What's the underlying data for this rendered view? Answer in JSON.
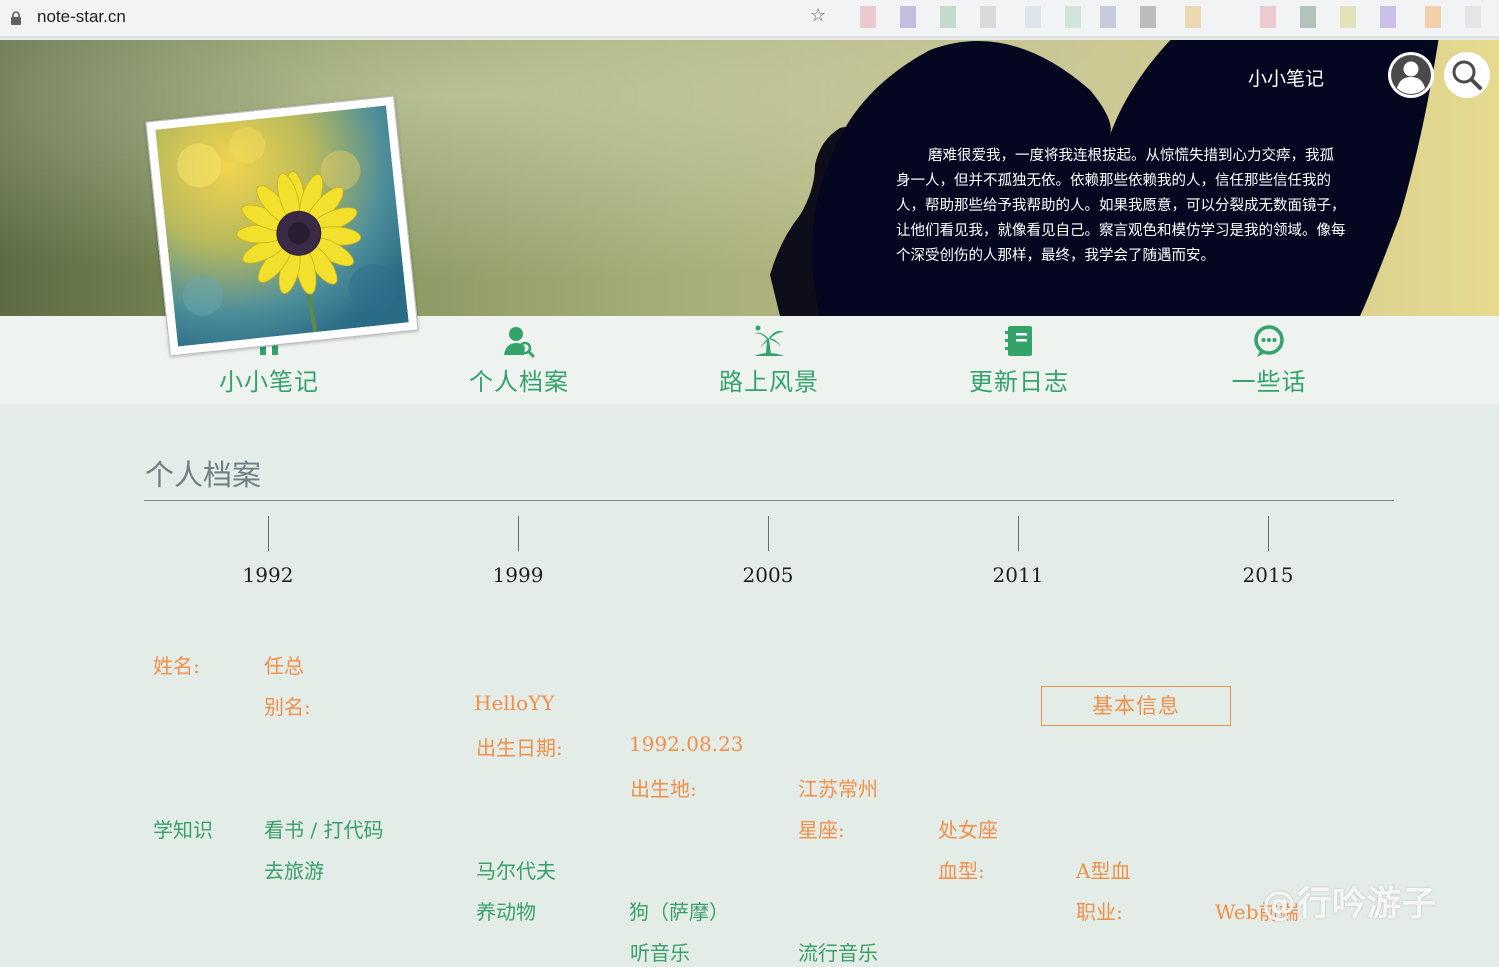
{
  "browser": {
    "url": "note-star.cn"
  },
  "header": {
    "site_title": "小小笔记",
    "quote": "磨难很爱我，一度将我连根拔起。从惊慌失措到心力交瘁，我孤身一人，但并不孤独无依。依赖那些依赖我的人，信任那些信任我的人，帮助那些给予我帮助的人。如果我愿意，可以分裂成无数面镜子，让他们看见我，就像看见自己。察言观色和模仿学习是我的领域。像每个深受创伤的人那样，最终，我学会了随遇而安。"
  },
  "nav": {
    "items": [
      {
        "label": "小小笔记",
        "icon": "home-icon"
      },
      {
        "label": "个人档案",
        "icon": "user-search-icon"
      },
      {
        "label": "路上风景",
        "icon": "palm-tree-icon"
      },
      {
        "label": "更新日志",
        "icon": "notebook-icon"
      },
      {
        "label": "一些话",
        "icon": "chat-bubble-icon"
      }
    ]
  },
  "profile": {
    "title": "个人档案",
    "timeline": [
      "1992",
      "1999",
      "2005",
      "2011",
      "2015"
    ],
    "info_tag": "基本信息",
    "name_label": "姓名:",
    "name_value": "任总",
    "alias_label": "别名:",
    "alias_value": "HelloYY",
    "birthday_label": "出生日期:",
    "birthday_value": "1992.08.23",
    "birthplace_label": "出生地:",
    "birthplace_value": "江苏常州",
    "zodiac_label": "星座:",
    "zodiac_value": "处女座",
    "blood_label": "血型:",
    "blood_value": "A型血",
    "job_label": "职业:",
    "job_value": "Web前端",
    "hobby_label_1": "学知识",
    "hobby_value_1": "看书 / 打代码",
    "hobby_label_2": "去旅游",
    "hobby_value_2": "马尔代夫",
    "hobby_label_3": "养动物",
    "hobby_value_3": "狗（萨摩）",
    "hobby_label_4": "听音乐",
    "hobby_value_4": "流行音乐"
  },
  "watermark": "@行吟游子",
  "colors": {
    "accent_green": "#33a36a",
    "accent_orange": "#f09048",
    "page_bg": "#e4ece7"
  }
}
